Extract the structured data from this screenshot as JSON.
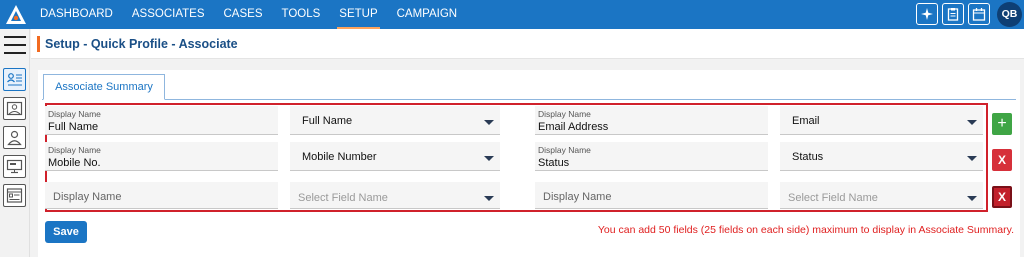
{
  "nav": {
    "items": [
      "DASHBOARD",
      "ASSOCIATES",
      "CASES",
      "TOOLS",
      "SETUP",
      "CAMPAIGN"
    ],
    "active_index": 4
  },
  "top_icons": [
    "sparkle-icon",
    "clipboard-icon",
    "calendar-icon"
  ],
  "user": {
    "initials": "QB"
  },
  "sidebar": {
    "icons": [
      "menu-icon",
      "profile-list-icon",
      "image-icon",
      "person-icon",
      "monitor-icon",
      "window-list-icon"
    ]
  },
  "page": {
    "title": "Setup - Quick Profile - Associate"
  },
  "tab": {
    "label": "Associate Summary"
  },
  "rows": [
    {
      "left": {
        "label": "Display Name",
        "value": "Full Name",
        "select": "Full Name"
      },
      "right": {
        "label": "Display Name",
        "value": "Email Address",
        "select": "Email"
      },
      "action": "+"
    },
    {
      "left": {
        "label": "Display Name",
        "value": "Mobile No.",
        "select": "Mobile Number"
      },
      "right": {
        "label": "Display Name",
        "value": "Status",
        "select": "Status"
      },
      "action": "X"
    },
    {
      "left": {
        "placeholder": "Display Name",
        "select_placeholder": "Select Field Name"
      },
      "right": {
        "placeholder": "Display Name",
        "select_placeholder": "Select Field Name"
      },
      "action": "X"
    }
  ],
  "save_label": "Save",
  "note": "You can add 50 fields (25 fields on each side) maximum to display in Associate Summary.",
  "colors": {
    "primary": "#1b75c4",
    "accent": "#f26b21",
    "danger": "#d6303a",
    "success": "#3fa545"
  }
}
